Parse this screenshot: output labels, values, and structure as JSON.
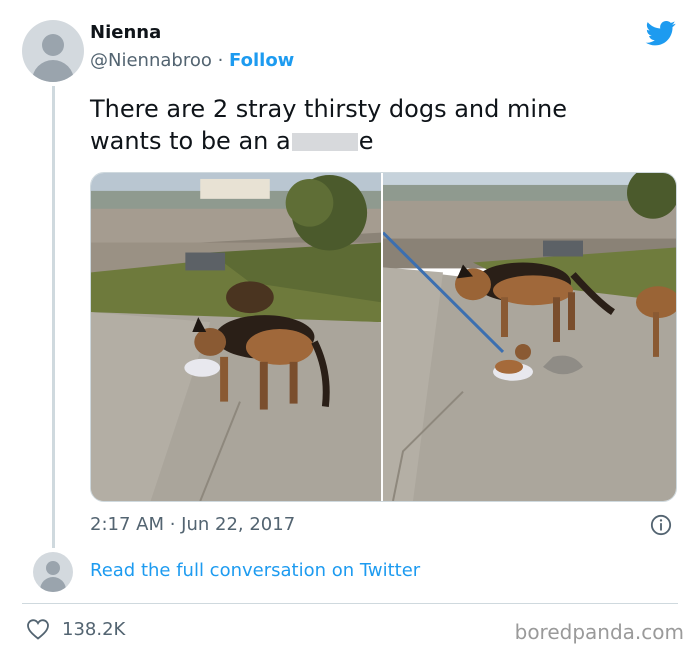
{
  "author": {
    "name": "Nienna",
    "handle": "@Niennabroo",
    "separator": "·",
    "follow_label": "Follow"
  },
  "tweet": {
    "text_line1": "There are 2 stray thirsty dogs and mine",
    "text_line2_start": "wants to be an a",
    "text_line2_end": "e",
    "timestamp": "2:17 AM · Jun 22, 2017"
  },
  "conversation": {
    "link_label": "Read the full conversation on Twitter"
  },
  "stats": {
    "likes": "138.2K"
  },
  "watermark": "boredpanda.com",
  "icons": {
    "brand": "twitter-bird-icon",
    "info": "info-icon",
    "like": "heart-icon"
  },
  "colors": {
    "twitter_blue": "#1d9bf0",
    "text_primary": "#0f1419",
    "text_secondary": "#536471",
    "border": "#cfd9de"
  }
}
